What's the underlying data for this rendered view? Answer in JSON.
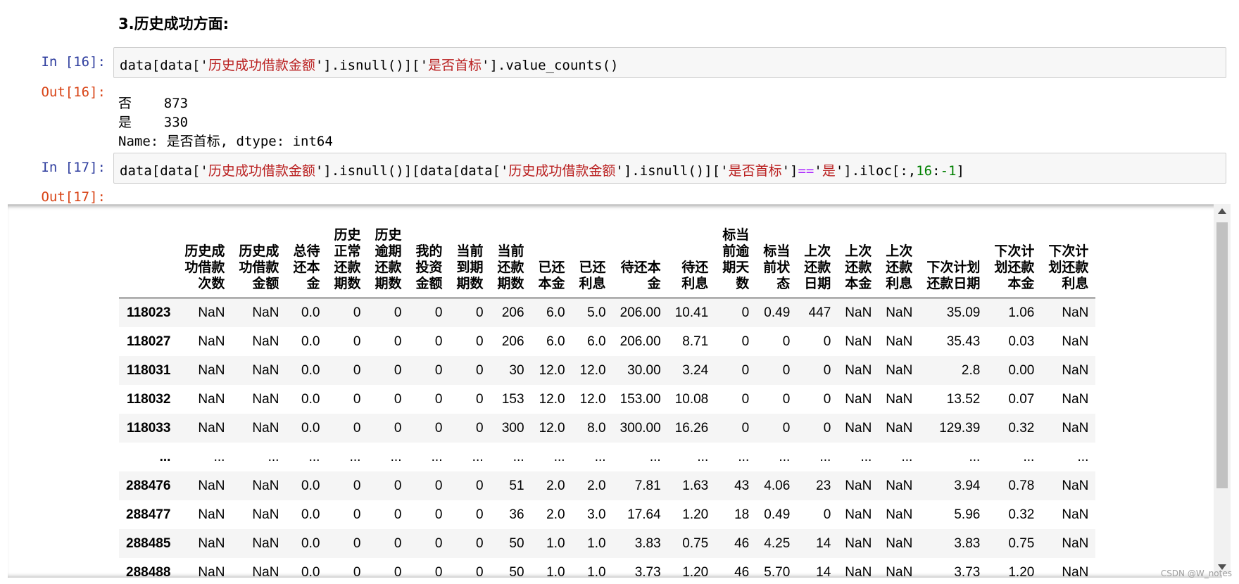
{
  "heading": "3.历史成功方面:",
  "cells": [
    {
      "in_prompt": "In  [16]:",
      "out_prompt": "Out[16]:",
      "code": [
        {
          "t": "data[data['"
        },
        {
          "t": "历史成功借款金额",
          "c": "str"
        },
        {
          "t": "'].isnull()]['"
        },
        {
          "t": "是否首标",
          "c": "str"
        },
        {
          "t": "'].value_counts()"
        }
      ],
      "output_lines": [
        "否    873",
        "是    330",
        "Name: 是否首标, dtype: int64"
      ]
    },
    {
      "in_prompt": "In  [17]:",
      "out_prompt": "Out[17]:",
      "code": [
        {
          "t": "data[data['"
        },
        {
          "t": "历史成功借款金额",
          "c": "str"
        },
        {
          "t": "'].isnull()][data[data['"
        },
        {
          "t": "历史成功借款金额",
          "c": "str"
        },
        {
          "t": "'].isnull()]['"
        },
        {
          "t": "是否首标",
          "c": "str"
        },
        {
          "t": "']"
        },
        {
          "t": "==",
          "c": "op"
        },
        {
          "t": "'"
        },
        {
          "t": "是",
          "c": "str"
        },
        {
          "t": "'].iloc[:,"
        },
        {
          "t": "16",
          "c": "num"
        },
        {
          "t": ":"
        },
        {
          "t": "-1",
          "c": "num"
        },
        {
          "t": "]"
        }
      ]
    }
  ],
  "table": {
    "columns": [
      [
        "历史成",
        "功借款",
        "次数"
      ],
      [
        "历史成",
        "功借款",
        "金额"
      ],
      [
        "总待",
        "还本",
        "金"
      ],
      [
        "历史",
        "正常",
        "还款",
        "期数"
      ],
      [
        "历史",
        "逾期",
        "还款",
        "期数"
      ],
      [
        "我的",
        "投资",
        "金额"
      ],
      [
        "当前",
        "到期",
        "期数"
      ],
      [
        "当前",
        "还款",
        "期数"
      ],
      [
        "已还",
        "本金"
      ],
      [
        "已还",
        "利息"
      ],
      [
        "待还本",
        "金"
      ],
      [
        "待还",
        "利息"
      ],
      [
        "标当",
        "前逾",
        "期天",
        "数"
      ],
      [
        "标当",
        "前状",
        "态"
      ],
      [
        "上次",
        "还款",
        "日期"
      ],
      [
        "上次",
        "还款",
        "本金"
      ],
      [
        "上次",
        "还款",
        "利息"
      ],
      [
        "下次计划",
        "还款日期"
      ],
      [
        "下次计",
        "划还款",
        "本金"
      ],
      [
        "下次计",
        "划还款",
        "利息"
      ]
    ],
    "rows": [
      {
        "index": "118023",
        "cells": [
          "NaN",
          "NaN",
          "0.0",
          "0",
          "0",
          "0",
          "0",
          "206",
          "6.0",
          "5.0",
          "206.00",
          "10.41",
          "0",
          "0.49",
          "447",
          "NaN",
          "NaN",
          "35.09",
          "1.06",
          "NaN"
        ]
      },
      {
        "index": "118027",
        "cells": [
          "NaN",
          "NaN",
          "0.0",
          "0",
          "0",
          "0",
          "0",
          "206",
          "6.0",
          "6.0",
          "206.00",
          "8.71",
          "0",
          "0",
          "0",
          "NaN",
          "NaN",
          "35.43",
          "0.03",
          "NaN"
        ]
      },
      {
        "index": "118031",
        "cells": [
          "NaN",
          "NaN",
          "0.0",
          "0",
          "0",
          "0",
          "0",
          "30",
          "12.0",
          "12.0",
          "30.00",
          "3.24",
          "0",
          "0",
          "0",
          "NaN",
          "NaN",
          "2.8",
          "0.00",
          "NaN"
        ]
      },
      {
        "index": "118032",
        "cells": [
          "NaN",
          "NaN",
          "0.0",
          "0",
          "0",
          "0",
          "0",
          "153",
          "12.0",
          "12.0",
          "153.00",
          "10.08",
          "0",
          "0",
          "0",
          "NaN",
          "NaN",
          "13.52",
          "0.07",
          "NaN"
        ]
      },
      {
        "index": "118033",
        "cells": [
          "NaN",
          "NaN",
          "0.0",
          "0",
          "0",
          "0",
          "0",
          "300",
          "12.0",
          "8.0",
          "300.00",
          "16.26",
          "0",
          "0",
          "0",
          "NaN",
          "NaN",
          "129.39",
          "0.32",
          "NaN"
        ]
      },
      {
        "index": "...",
        "cells": [
          "...",
          "...",
          "...",
          "...",
          "...",
          "...",
          "...",
          "...",
          "...",
          "...",
          "...",
          "...",
          "...",
          "...",
          "...",
          "...",
          "...",
          "...",
          "...",
          "..."
        ]
      },
      {
        "index": "288476",
        "cells": [
          "NaN",
          "NaN",
          "0.0",
          "0",
          "0",
          "0",
          "0",
          "51",
          "2.0",
          "2.0",
          "7.81",
          "1.63",
          "43",
          "4.06",
          "23",
          "NaN",
          "NaN",
          "3.94",
          "0.78",
          "NaN"
        ]
      },
      {
        "index": "288477",
        "cells": [
          "NaN",
          "NaN",
          "0.0",
          "0",
          "0",
          "0",
          "0",
          "36",
          "2.0",
          "3.0",
          "17.64",
          "1.20",
          "18",
          "0.49",
          "0",
          "NaN",
          "NaN",
          "5.96",
          "0.32",
          "NaN"
        ]
      },
      {
        "index": "288485",
        "cells": [
          "NaN",
          "NaN",
          "0.0",
          "0",
          "0",
          "0",
          "0",
          "50",
          "1.0",
          "1.0",
          "3.83",
          "0.75",
          "46",
          "4.25",
          "14",
          "NaN",
          "NaN",
          "3.83",
          "0.75",
          "NaN"
        ]
      },
      {
        "index": "288488",
        "cells": [
          "NaN",
          "NaN",
          "0.0",
          "0",
          "0",
          "0",
          "0",
          "50",
          "1.0",
          "1.0",
          "3.73",
          "1.20",
          "46",
          "5.70",
          "14",
          "NaN",
          "NaN",
          "3.73",
          "1.20",
          "NaN"
        ]
      }
    ]
  },
  "watermark": "CSDN @W_notes"
}
